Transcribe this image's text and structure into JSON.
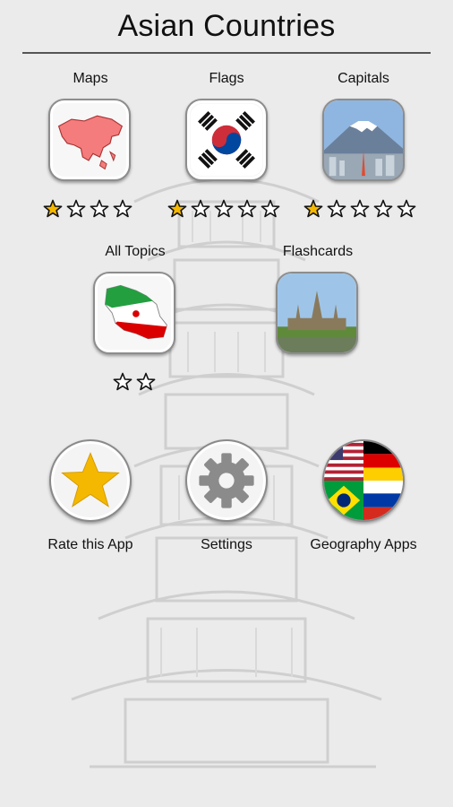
{
  "title": "Asian Countries",
  "topics": [
    {
      "label": "Maps",
      "stars_filled": 1,
      "stars_total": 4
    },
    {
      "label": "Flags",
      "stars_filled": 1,
      "stars_total": 5
    },
    {
      "label": "Capitals",
      "stars_filled": 1,
      "stars_total": 5
    },
    {
      "label": "All Topics",
      "stars_filled": 0,
      "stars_total": 2
    },
    {
      "label": "Flashcards"
    }
  ],
  "actions": [
    {
      "label": "Rate this App"
    },
    {
      "label": "Settings"
    },
    {
      "label": "Geography Apps"
    }
  ],
  "colors": {
    "star_filled": "#f5b800",
    "star_outline": "#111111",
    "background": "#ebebeb"
  }
}
